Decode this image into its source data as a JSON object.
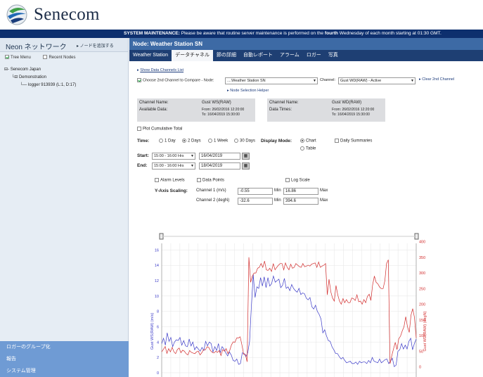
{
  "app": {
    "brand": "Senecom",
    "maintenance_label": "SYSTEM MAINTENANCE:",
    "maintenance_text": "Please be aware that routine server maintenance is performed on the",
    "maintenance_emph": "fourth",
    "maintenance_tail": "Wednesday of each month starting at 01:30 GMT."
  },
  "sidebar": {
    "title": "Neon ネットワーク",
    "add_node": "▸ ノードを追加する",
    "collapse": "◂",
    "tree_menu": "Tree Menu",
    "recent_nodes": "Recent Nodes",
    "tree": {
      "root": "Senecom Japan",
      "group": "Demonstration",
      "logger": "logger 913939 (L:1, D:17)"
    },
    "footer": [
      "ロガーのグループ化",
      "報告",
      "システム管理"
    ]
  },
  "main": {
    "node_title": "Node: Weather Station SN",
    "tabs": [
      "Weather Station",
      "データチャネル",
      "節の詳細",
      "自動レポート",
      "アラーム",
      "ロガー",
      "写真"
    ],
    "active_tab": 1,
    "show_channels": "Show Data Channels List",
    "compare_label": "Choose 2nd Channel to Compare - Node:",
    "compare_node": "....Weather Station SN",
    "channel_label": "Channel:",
    "channel_value": "Gust WD(RAW) - Active",
    "clear_2nd": "Clear 2nd Channel",
    "node_helper": "Node Selection Helper",
    "ch1": {
      "name_label": "Channel Name:",
      "name": "Gust WS(RAW)",
      "avail_label": "Available Data:",
      "from": "From: 26/02/2016 12:20:00",
      "to": "To:     16/04/2019 15:30:00"
    },
    "ch2": {
      "name_label": "Channel Name:",
      "name": "Gust WD(RAW)",
      "times_label": "Data Times:",
      "from": "From: 26/02/2016 12:20:00",
      "to": "To:     16/04/2019 15:30:00"
    },
    "plot_cumulative": "Plot Cumulative Total",
    "time_label": "Time:",
    "time_options": [
      "1 Day",
      "2 Days",
      "1 Week",
      "30 Days"
    ],
    "display_mode_label": "Display Mode:",
    "display_chart": "Chart",
    "display_table": "Table",
    "daily_summaries": "Daily Summaries",
    "start_label": "Start:",
    "start_time": "15:00 - 16:00 Hrs",
    "start_date": "16/04/2019",
    "end_label": "End:",
    "end_time": "15:00 - 16:00 Hrs",
    "end_date": "18/04/2019",
    "alarm_levels": "Alarm Levels",
    "data_points": "Data Points",
    "log_scale": "Log Scale",
    "y_axis_scaling": "Y-Axis Scaling:",
    "channel1_label": "Channel 1 (m/s)",
    "channel1_min": "-0.55",
    "channel1_max": "16.86",
    "channel2_label": "Channel 2 (degN)",
    "channel2_min": "-32.6",
    "channel2_max": "394.6",
    "min_label": "Min",
    "max_label": "Max"
  },
  "chart_data": {
    "type": "line",
    "y_left_label": "Gust WS(RAW) (m/s)",
    "y_right_label": "Gust WD(RAW) (degN)",
    "y_left_ticks": [
      0,
      2,
      4,
      6,
      8,
      10,
      12,
      14,
      16
    ],
    "y_right_ticks": [
      0,
      50,
      100,
      150,
      200,
      250,
      300,
      350,
      400
    ],
    "ylim_left": [
      -0.55,
      16.86
    ],
    "ylim_right": [
      -32.6,
      394.6
    ],
    "grid": true,
    "series": [
      {
        "axis": "left",
        "color": "#3b3bc8",
        "values": [
          3.8,
          4.5,
          3.6,
          5.2,
          4.1,
          4.6,
          3.4,
          4.0,
          4.3,
          4.2,
          4.6,
          3.6,
          4.2,
          3.5,
          3.4,
          4.4,
          3.5,
          4.0,
          3.0,
          3.4,
          3.1,
          2.8,
          3.3,
          2.9,
          4.1,
          3.5,
          4.0,
          3.8,
          2.7,
          3.4,
          2.9,
          3.8,
          2.6,
          3.4,
          3.1,
          2.6,
          2.2,
          2.7,
          2.3,
          1.6,
          1.5,
          1.8,
          1.1,
          1.2,
          2.6,
          2.5,
          2.1,
          2.6,
          4.1,
          8.8,
          12.8,
          9.8,
          11.2,
          11.0,
          12.4,
          11.3,
          12.5,
          11.1,
          12.4,
          11.3,
          11.6,
          12.6,
          11.8,
          12.0,
          12.2,
          11.1,
          11.4,
          12.3,
          11.0,
          11.2,
          10.7,
          11.5,
          11.0,
          10.7,
          10.5,
          11.0,
          10.2,
          10.4,
          10.3,
          9.7,
          9.5,
          9.8,
          8.6,
          8.3,
          8.8,
          8.0,
          7.6,
          7.0,
          5.2,
          5.6,
          4.8,
          4.2,
          4.1,
          3.4,
          3.0,
          2.5,
          2.5,
          2.1,
          1.8,
          2.0,
          1.6,
          1.3,
          1.4,
          1.5,
          1.2,
          1.2,
          1.4,
          1.1,
          1.5,
          1.3,
          1.4,
          1.4,
          1.2,
          1.6,
          1.3,
          2.0,
          1.5,
          1.4,
          1.3,
          1.8,
          1.3,
          1.5,
          1.7,
          1.8,
          1.2,
          1.5,
          1.9,
          0.8,
          1.0,
          2.8,
          3.0,
          3.8,
          3.1,
          3.6,
          3.1,
          4.1,
          4.5,
          3.0,
          3.8,
          4.4
        ]
      },
      {
        "axis": "right",
        "color": "#d22c2c",
        "values": [
          48,
          56,
          65,
          43,
          58,
          48,
          62,
          48,
          42,
          55,
          60,
          45,
          53,
          50,
          42,
          38,
          52,
          46,
          44,
          42,
          48,
          50,
          38,
          45,
          55,
          54,
          64,
          62,
          52,
          46,
          44,
          50,
          46,
          52,
          36,
          55,
          50,
          58,
          42,
          52,
          70,
          80,
          78,
          92,
          92,
          96,
          70,
          40,
          40,
          16,
          350,
          270,
          290,
          300,
          300,
          315,
          318,
          330,
          318,
          338,
          310,
          308,
          315,
          305,
          330,
          310,
          318,
          325,
          330,
          330,
          310,
          332,
          318,
          310,
          328,
          315,
          318,
          330,
          325,
          320,
          318,
          330,
          320,
          322,
          325,
          322,
          328,
          330,
          332,
          318,
          335,
          318,
          322,
          325,
          330,
          230,
          280,
          240,
          220,
          210,
          260,
          230,
          210,
          200,
          218,
          205,
          215,
          205,
          205,
          220,
          218,
          212,
          230,
          208,
          210,
          200,
          215,
          205,
          225,
          232,
          212,
          262,
          290,
          270,
          265,
          255,
          250,
          250,
          275,
          330,
          342,
          10,
          36,
          58,
          78,
          55,
          90,
          98,
          115,
          128,
          160,
          128,
          110,
          165,
          186,
          158,
          92
        ]
      }
    ]
  },
  "colors": {
    "brand_blue": "#0d2f6e",
    "node_bar": "#3d6aa5",
    "sidebar_footer": "#6f9bd4",
    "ws_series": "#3b3bc8",
    "wd_series": "#d22c2c"
  }
}
